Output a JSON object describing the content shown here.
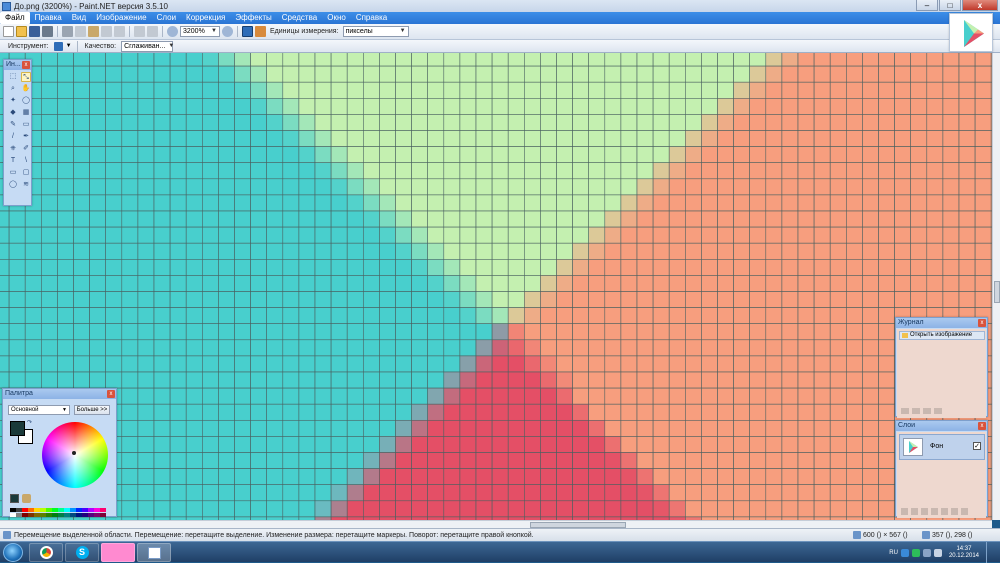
{
  "window": {
    "title": "До.png (3200%) - Paint.NET версия 3.5.10",
    "controls": {
      "minimize": "–",
      "maximize": "□",
      "close": "x"
    }
  },
  "menu": [
    "Файл",
    "Правка",
    "Вид",
    "Изображение",
    "Слои",
    "Коррекция",
    "Эффекты",
    "Средства",
    "Окно",
    "Справка"
  ],
  "toolbar": {
    "zoom": "3200%",
    "units_label": "Единицы измерения:",
    "units_value": "пикселы"
  },
  "options_bar": {
    "tool_label": "Инструмент:",
    "quality_label": "Качество:",
    "quality_value": "Сглаживан..."
  },
  "tools_window": {
    "title": "Ин...",
    "close": "x",
    "tools": [
      "move-selection",
      "move-selected",
      "zoom",
      "pan",
      "magic-wand",
      "lasso",
      "paint-bucket",
      "gradient",
      "paintbrush",
      "eraser",
      "pencil",
      "color-picker",
      "clone-stamp",
      "recolor",
      "text",
      "line",
      "rectangle",
      "rounded-rectangle",
      "ellipse",
      "freeform-shape"
    ],
    "tool_glyphs": [
      "⬚",
      "⤡",
      "⌕",
      "✋",
      "✦",
      "◯",
      "◆",
      "▦",
      "✎",
      "▭",
      "/",
      "✒",
      "⎈",
      "✐",
      "T",
      "\\",
      "▭",
      "▢",
      "◯",
      "≋"
    ]
  },
  "palette_window": {
    "title": "Палитра",
    "close": "x",
    "mode": "Основной",
    "more_button": "Больше >>",
    "primary_color": "#1a3a3a",
    "secondary_color": "#ffffff",
    "swatches": [
      "#000000",
      "#404040",
      "#ff0000",
      "#ff6a00",
      "#ffd800",
      "#b6ff00",
      "#4cff00",
      "#00ff21",
      "#00ff90",
      "#00ffff",
      "#0094ff",
      "#0026ff",
      "#4800ff",
      "#b200ff",
      "#ff00dc",
      "#ff006e",
      "#ffffff",
      "#808080",
      "#7f0000",
      "#7f3300",
      "#7f6a00",
      "#5b7f00",
      "#267f00",
      "#007f0e",
      "#007f46",
      "#007f7f",
      "#004a7f",
      "#00137f",
      "#21007f",
      "#57007f",
      "#7f006e",
      "#7f0037"
    ]
  },
  "history_window": {
    "title": "Журнал",
    "close": "x",
    "items": [
      "Открыть изображение"
    ]
  },
  "layers_window": {
    "title": "Слои",
    "close": "x",
    "layers": [
      {
        "name": "Фон",
        "visible": true
      }
    ]
  },
  "statusbar": {
    "message": "Перемещение выделенной области. Перемещение: перетащите выделение. Изменение размера: перетащите маркеры. Поворот: перетащите правой кнопкой.",
    "image_size": "600 () × 567 ()",
    "cursor_pos": "357 (), 298 ()"
  },
  "taskbar": {
    "language": "RU",
    "time": "14:37",
    "date": "20.12.2014"
  },
  "colors": {
    "cyan": "#48cfcd",
    "cyan_bright": "#3fe0e0",
    "green": "#c4f0b0",
    "orange": "#f79e7e",
    "red": "#e44f66",
    "grid": "#4a6060"
  }
}
